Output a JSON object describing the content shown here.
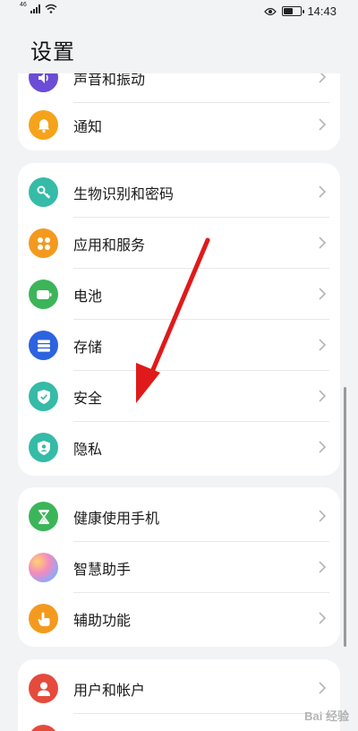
{
  "status": {
    "signal_label": "46",
    "time": "14:43"
  },
  "page": {
    "title": "设置"
  },
  "groups": [
    {
      "items": [
        {
          "label": "声音和振动",
          "icon": "speaker-icon",
          "color": "#6b4cd6"
        },
        {
          "label": "通知",
          "icon": "bell-icon",
          "color": "#f5a31a"
        }
      ]
    },
    {
      "items": [
        {
          "label": "生物识别和密码",
          "icon": "key-icon",
          "color": "#35bba7"
        },
        {
          "label": "应用和服务",
          "icon": "apps-grid-icon",
          "color": "#f39a1e"
        },
        {
          "label": "电池",
          "icon": "battery-icon",
          "color": "#3cb55a"
        },
        {
          "label": "存储",
          "icon": "storage-icon",
          "color": "#2d63e0"
        },
        {
          "label": "安全",
          "icon": "shield-icon",
          "color": "#35bba7"
        },
        {
          "label": "隐私",
          "icon": "privacy-icon",
          "color": "#35bba7"
        }
      ]
    },
    {
      "items": [
        {
          "label": "健康使用手机",
          "icon": "hourglass-icon",
          "color": "#3cb55a"
        },
        {
          "label": "智慧助手",
          "icon": "assistant-icon",
          "color": "#b38cf0"
        },
        {
          "label": "辅助功能",
          "icon": "hand-icon",
          "color": "#f39a1e"
        }
      ]
    },
    {
      "items": [
        {
          "label": "用户和帐户",
          "icon": "user-icon",
          "color": "#e54b3c"
        }
      ]
    }
  ],
  "watermark": {
    "text": "Bai 经验"
  }
}
